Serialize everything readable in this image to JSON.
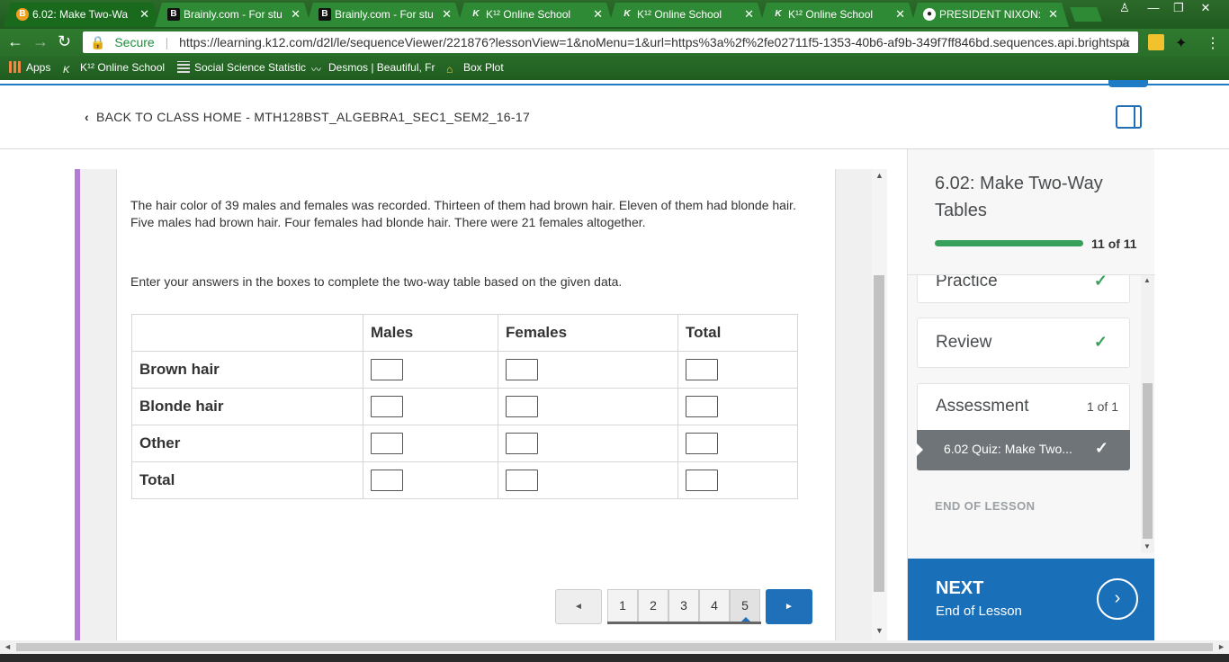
{
  "browser": {
    "tabs": [
      {
        "title": "6.02: Make Two-Wa",
        "icon": "b-badge-icon",
        "active": true
      },
      {
        "title": "Brainly.com - For stu",
        "icon": "brainly-icon"
      },
      {
        "title": "Brainly.com - For stu",
        "icon": "brainly-icon"
      },
      {
        "title": "K¹² Online School",
        "icon": "k12-icon"
      },
      {
        "title": "K¹² Online School",
        "icon": "k12-icon"
      },
      {
        "title": "K¹² Online School",
        "icon": "k12-icon"
      },
      {
        "title": "PRESIDENT NIXON:",
        "icon": "chrome-icon"
      }
    ],
    "close_glyph": "✕",
    "secure_label": "Secure",
    "url": "https://learning.k12.com/d2l/le/sequenceViewer/221876?lessonView=1&noMenu=1&url=https%3a%2f%2fe02711f5-1353-40b6-af9b-349f7ff846bd.sequences.api.brightspa",
    "bookmarks": [
      {
        "label": "Apps",
        "icon": "apps-grid-icon"
      },
      {
        "label": "K¹² Online School",
        "icon": "k12-icon"
      },
      {
        "label": "Social Science Statistic",
        "icon": "table-icon"
      },
      {
        "label": "Desmos | Beautiful, Fr",
        "icon": "desmos-icon"
      },
      {
        "label": "Box Plot",
        "icon": "boxplot-icon"
      }
    ]
  },
  "header": {
    "back_label": "BACK TO CLASS HOME - MTH128BST_ALGEBRA1_SEC1_SEM2_16-17"
  },
  "question": {
    "paragraph1": "The hair color of 39 males and females was recorded. Thirteen of them had brown hair. Eleven of them had blonde hair. Five males had brown hair. Four females had blonde hair. There were 21 females altogether.",
    "paragraph2": "Enter your answers in the boxes to complete the two-way table based on the given data.",
    "table": {
      "columns": [
        "",
        "Males",
        "Females",
        "Total"
      ],
      "rows": [
        "Brown hair",
        "Blonde hair",
        "Other",
        "Total"
      ]
    }
  },
  "pagination": {
    "pages": [
      "1",
      "2",
      "3",
      "4",
      "5"
    ],
    "current": "5",
    "prev_glyph": "◄",
    "next_glyph": "►"
  },
  "sidebar": {
    "lesson_title": "6.02: Make Two-Way Tables",
    "progress_text": "11 of 11",
    "progress_fraction": 1.0,
    "items": [
      {
        "label": "Practice",
        "status": "complete"
      },
      {
        "label": "Review",
        "status": "complete"
      },
      {
        "label": "Assessment",
        "count": "1 of 1"
      }
    ],
    "quiz_label": "6.02 Quiz: Make Two...",
    "end_label": "END OF LESSON",
    "next": {
      "label": "NEXT",
      "sub": "End of Lesson"
    }
  },
  "colors": {
    "accent_blue": "#1a6fb9",
    "progress_green": "#37a05a",
    "purple_bar": "#b27bd6",
    "browser_green": "#2f7a2f"
  }
}
